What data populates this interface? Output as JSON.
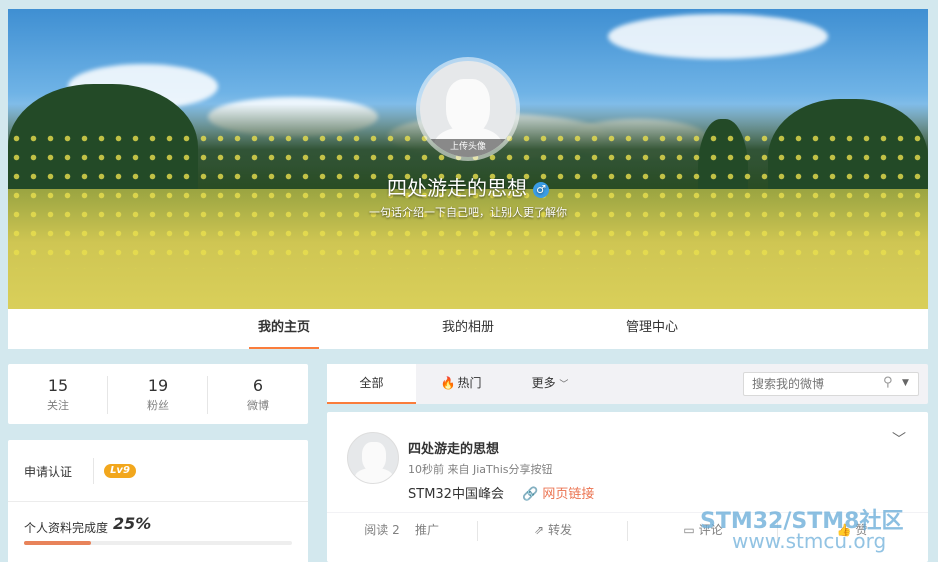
{
  "profile": {
    "avatar_upload_label": "上传头像",
    "nickname": "四处游走的思想",
    "gender_icon": "♂",
    "intro": "一句话介绍一下自己吧，让别人更了解你"
  },
  "nav_tabs": [
    {
      "label": "我的主页",
      "active": true
    },
    {
      "label": "我的相册",
      "active": false
    },
    {
      "label": "管理中心",
      "active": false
    }
  ],
  "stats": [
    {
      "value": "15",
      "label": "关注"
    },
    {
      "value": "19",
      "label": "粉丝"
    },
    {
      "value": "6",
      "label": "微博"
    }
  ],
  "verify": {
    "apply_label": "申请认证",
    "level_badge": "Lv9",
    "completion_label": "个人资料完成度",
    "completion_value": "25%",
    "completion_fraction": 0.25
  },
  "feed_tabs": {
    "all": "全部",
    "hot": "热门",
    "more": "更多",
    "search_placeholder": "搜索我的微博"
  },
  "post": {
    "author": "四处游走的思想",
    "meta": "10秒前 来自 JiaThis分享按钮",
    "text": "STM32中国峰会",
    "link": "网页链接",
    "actions": {
      "read": "阅读 2",
      "promote": "推广",
      "repost": "转发",
      "comment": "评论",
      "like": "赞"
    }
  },
  "watermark": {
    "line1": "STM32/STM8社区",
    "line2": "www.stmcu.org"
  },
  "colors": {
    "accent": "#fa7d3c",
    "link": "#eb7350",
    "level_badge": "#f2a71d",
    "page_bg": "#d3e8ee"
  }
}
